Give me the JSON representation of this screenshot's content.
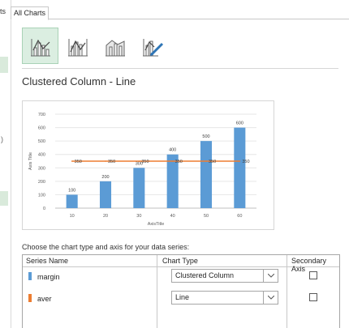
{
  "window": {
    "left_tab_fragment": "ts",
    "left_paren": ")",
    "tab_label": "All Charts"
  },
  "chart_types": [
    {
      "icon": "clustered-column-line-icon",
      "selected": true
    },
    {
      "icon": "clustered-column-line-secondary-icon",
      "selected": false
    },
    {
      "icon": "stacked-area-clustered-column-icon",
      "selected": false
    },
    {
      "icon": "custom-combination-icon",
      "selected": false
    }
  ],
  "combo_title": "Clustered Column - Line",
  "chart_data": {
    "type": "bar",
    "categories": [
      "10",
      "20",
      "30",
      "40",
      "50",
      "60"
    ],
    "series": [
      {
        "name": "margin",
        "type": "column",
        "values": [
          100,
          200,
          300,
          400,
          500,
          600
        ],
        "color": "#5b9bd5"
      },
      {
        "name": "aver",
        "type": "line",
        "values": [
          350,
          350,
          350,
          350,
          350,
          350
        ],
        "color": "#ed7d31"
      }
    ],
    "y_ticks": [
      "0",
      "100",
      "200",
      "300",
      "400",
      "500",
      "600",
      "700"
    ],
    "ylim": [
      0,
      700
    ],
    "xlabel": "AxisTitle",
    "ylabel": "Axis Title",
    "grid": true
  },
  "instructions": "Choose the chart type and axis for your data series:",
  "table": {
    "headers": {
      "name": "Series Name",
      "type": "Chart Type",
      "secondary": "Secondary Axis"
    },
    "rows": [
      {
        "name": "margin",
        "color": "#5b9bd5",
        "chart_type": "Clustered Column",
        "secondary": false
      },
      {
        "name": "aver",
        "color": "#ed7d31",
        "chart_type": "Line",
        "secondary": false
      }
    ]
  },
  "colors": {
    "accent_green": "#dbeee1",
    "column_blue": "#5b9bd5",
    "line_orange": "#ed7d31"
  }
}
